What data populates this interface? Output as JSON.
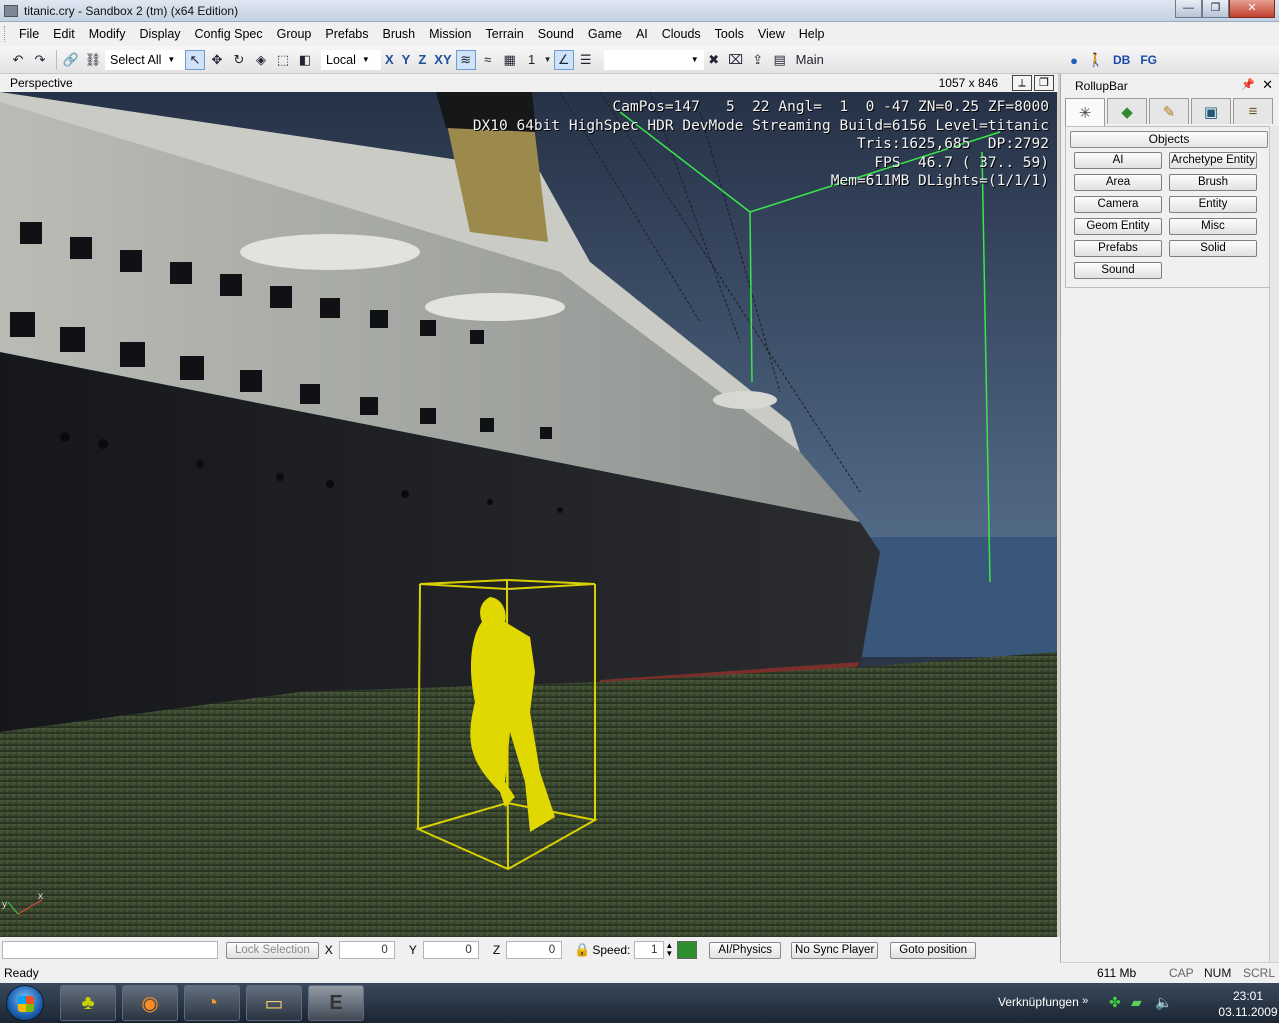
{
  "window": {
    "title": "titanic.cry - Sandbox 2 (tm) (x64 Edition)",
    "minimize": "—",
    "maximize": "❐",
    "close": "✕"
  },
  "menu": [
    "File",
    "Edit",
    "Modify",
    "Display",
    "Config Spec",
    "Group",
    "Prefabs",
    "Brush",
    "Mission",
    "Terrain",
    "Sound",
    "Game",
    "AI",
    "Clouds",
    "Tools",
    "View",
    "Help"
  ],
  "toolbar": {
    "selection_combo": "Select All",
    "coord_combo": "Local",
    "axis_x": "X",
    "axis_y": "Y",
    "axis_z": "Z",
    "axis_xy": "XY",
    "grid_value": "1",
    "layer_label": "Main",
    "db_label": "DB",
    "fg_label": "FG"
  },
  "viewport": {
    "name": "Perspective",
    "resolution": "1057 x 846",
    "hud": [
      "CamPos=147   5  22 Angl=  1  0 -47 ZN=0.25 ZF=8000",
      "DX10 64bit HighSpec HDR DevMode Streaming Build=6156 Level=titanic",
      "Tris:1625,685  DP:2792",
      "FPS  46.7 ( 37.. 59)",
      "Mem=611MB DLights=(1/1/1)"
    ],
    "axis_y": "y",
    "axis_x": "x"
  },
  "rollup": {
    "title": "RollupBar",
    "pin": "📌",
    "close": "✕",
    "tabs": [
      {
        "icon": "create-objects-icon",
        "glyph": "✳"
      },
      {
        "icon": "modify-terrain-icon",
        "glyph": "◆"
      },
      {
        "icon": "display-brush-icon",
        "glyph": "✎"
      },
      {
        "icon": "monitor-icon",
        "glyph": "▣"
      },
      {
        "icon": "layers-icon",
        "glyph": "≡"
      }
    ],
    "objects_header": "Objects",
    "buttons": [
      "AI",
      "Archetype Entity",
      "Area",
      "Brush",
      "Camera",
      "Entity",
      "Geom Entity",
      "Misc",
      "Prefabs",
      "Solid",
      "Sound"
    ]
  },
  "status": {
    "lock_selection": "Lock Selection",
    "x_label": "X",
    "x_value": "0",
    "y_label": "Y",
    "y_value": "0",
    "z_label": "Z",
    "z_value": "0",
    "speed_label": "Speed:",
    "speed_value": "1",
    "ai_physics": "AI/Physics",
    "no_sync_player": "No Sync Player",
    "goto_position": "Goto position",
    "ready": "Ready",
    "memory": "611 Mb",
    "cap": "CAP",
    "num": "NUM",
    "scrl": "SCRL"
  },
  "taskbar": {
    "links": "Verknüpfungen",
    "chevron": "»",
    "time": "23:01",
    "date": "03.11.2009"
  }
}
